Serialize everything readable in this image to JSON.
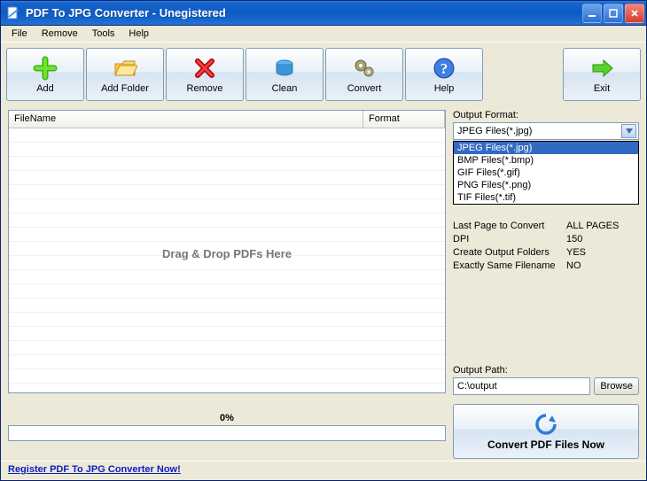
{
  "titlebar": {
    "title": "PDF To JPG Converter - Unegistered"
  },
  "menu": {
    "file": "File",
    "remove": "Remove",
    "tools": "Tools",
    "help": "Help"
  },
  "toolbar": {
    "add": "Add",
    "addfolder": "Add Folder",
    "remove": "Remove",
    "clean": "Clean",
    "convert": "Convert",
    "help": "Help",
    "exit": "Exit"
  },
  "filelist": {
    "col_name": "FileName",
    "col_fmt": "Format",
    "drop_hint": "Drag & Drop PDFs Here"
  },
  "progress": {
    "pct": "0%"
  },
  "output_format": {
    "label": "Output Format:",
    "selected": "JPEG Files(*.jpg)",
    "options": [
      "JPEG Files(*.jpg)",
      "BMP Files(*.bmp)",
      "GIF Files(*.gif)",
      "PNG Files(*.png)",
      "TIF Files(*.tif)"
    ]
  },
  "settings": {
    "last_page_k": "Last Page to Convert",
    "last_page_v": "ALL PAGES",
    "dpi_k": "DPI",
    "dpi_v": "150",
    "create_folders_k": "Create Output Folders",
    "create_folders_v": "YES",
    "same_name_k": "Exactly Same Filename",
    "same_name_v": "NO"
  },
  "output_path": {
    "label": "Output Path:",
    "value": "C:\\output",
    "browse": "Browse"
  },
  "convert_big": "Convert PDF Files Now",
  "footer": {
    "register": "Register PDF To JPG Converter Now!"
  }
}
